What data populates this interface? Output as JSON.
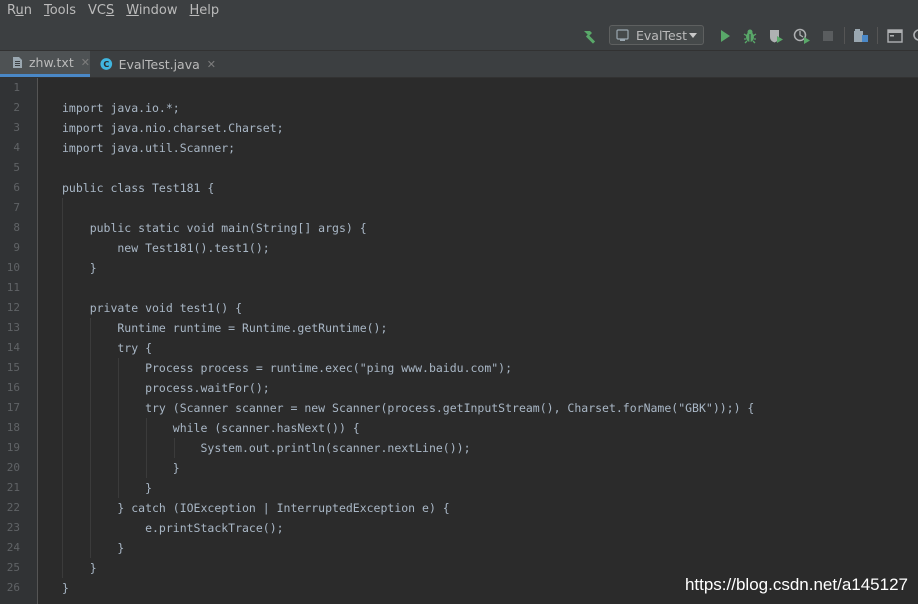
{
  "menu": {
    "items": [
      {
        "pre": "R",
        "u": "u",
        "post": "n"
      },
      {
        "pre": "",
        "u": "T",
        "post": "ools"
      },
      {
        "pre": "VC",
        "u": "S",
        "post": ""
      },
      {
        "pre": "",
        "u": "W",
        "post": "indow"
      },
      {
        "pre": "",
        "u": "H",
        "post": "elp"
      }
    ]
  },
  "toolbar": {
    "run_config": "EvalTest",
    "icons": [
      "build-icon",
      "run-icon",
      "debug-icon",
      "coverage-icon",
      "profile-icon",
      "stop-icon",
      "project-structure-icon",
      "terminal-icon"
    ]
  },
  "tabs": [
    {
      "label": "zhw.txt",
      "active": true,
      "icon": "text-file-icon"
    },
    {
      "label": "EvalTest.java",
      "active": false,
      "icon": "java-class-icon"
    }
  ],
  "editor": {
    "lines": [
      "",
      "import java.io.*;",
      "import java.nio.charset.Charset;",
      "import java.util.Scanner;",
      "",
      "public class Test181 {",
      "",
      "    public static void main(String[] args) {",
      "        new Test181().test1();",
      "    }",
      "",
      "    private void test1() {",
      "        Runtime runtime = Runtime.getRuntime();",
      "        try {",
      "            Process process = runtime.exec(\"ping www.baidu.com\");",
      "            process.waitFor();",
      "            try (Scanner scanner = new Scanner(process.getInputStream(), Charset.forName(\"GBK\"));) {",
      "                while (scanner.hasNext()) {",
      "                    System.out.println(scanner.nextLine());",
      "                }",
      "            }",
      "        } catch (IOException | InterruptedException e) {",
      "            e.printStackTrace();",
      "        }",
      "    }",
      "}"
    ]
  },
  "watermark": "https://blog.csdn.net/a145127",
  "colors": {
    "menubar": "#3c3f41",
    "editor_bg": "#2b2b2b",
    "gutter_bg": "#313335",
    "code_text": "#a9b7c6",
    "line_number": "#606366",
    "run_green": "#59a869",
    "active_tab_underline": "#4a88c7"
  }
}
